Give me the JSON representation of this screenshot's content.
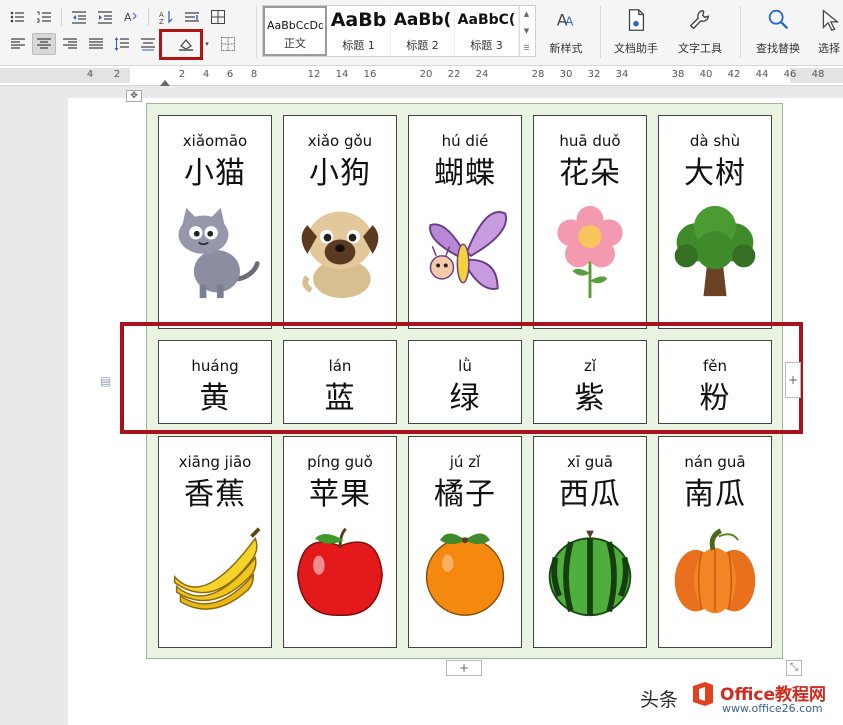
{
  "ribbon": {
    "styles": [
      {
        "sample": "AaBbCcDd",
        "label": "正文"
      },
      {
        "sample": "AaBb",
        "label": "标题 1"
      },
      {
        "sample": "AaBb(",
        "label": "标题 2"
      },
      {
        "sample": "AaBbC(",
        "label": "标题 3"
      }
    ],
    "tools": {
      "new_style": "新样式",
      "doc_assistant": "文档助手",
      "text_tools": "文字工具",
      "find_replace": "查找替换",
      "select": "选择"
    }
  },
  "ruler": {
    "numbers": [
      "4",
      "2",
      "2",
      "4",
      "6",
      "8",
      "12",
      "14",
      "16",
      "20",
      "22",
      "24",
      "28",
      "30",
      "32",
      "34",
      "38",
      "40",
      "42",
      "44",
      "46",
      "48"
    ]
  },
  "cards": {
    "animals": [
      {
        "pinyin": "xiǎomāo",
        "hanzi": "小猫",
        "image": "cat"
      },
      {
        "pinyin": "xiǎo gǒu",
        "hanzi": "小狗",
        "image": "pug-dog"
      },
      {
        "pinyin": "hú  dié",
        "hanzi": "蝴蝶",
        "image": "butterfly"
      },
      {
        "pinyin": "huā duǒ",
        "hanzi": "花朵",
        "image": "flower"
      },
      {
        "pinyin": "dà  shù",
        "hanzi": "大树",
        "image": "tree"
      }
    ],
    "colors": [
      {
        "pinyin": "huáng",
        "hanzi": "黄"
      },
      {
        "pinyin": "lán",
        "hanzi": "蓝"
      },
      {
        "pinyin": "lǜ",
        "hanzi": "绿"
      },
      {
        "pinyin": "zǐ",
        "hanzi": "紫"
      },
      {
        "pinyin": "fěn",
        "hanzi": "粉"
      }
    ],
    "fruits": [
      {
        "pinyin": "xiāng jiāo",
        "hanzi": "香蕉",
        "image": "banana"
      },
      {
        "pinyin": "píng guǒ",
        "hanzi": "苹果",
        "image": "apple"
      },
      {
        "pinyin": "jú   zǐ",
        "hanzi": "橘子",
        "image": "orange"
      },
      {
        "pinyin": "xī  guā",
        "hanzi": "西瓜",
        "image": "watermelon"
      },
      {
        "pinyin": "nán guā",
        "hanzi": "南瓜",
        "image": "pumpkin"
      }
    ]
  },
  "table_controls": {
    "add_row": "+",
    "add_col": "+"
  },
  "watermark": {
    "text": "头条",
    "brand": "Office教程网",
    "url": "www.office26.com"
  },
  "colors": {
    "highlight": "#a8121c",
    "table_bg": "#e8f3e2",
    "accent": "#2b65c6"
  }
}
